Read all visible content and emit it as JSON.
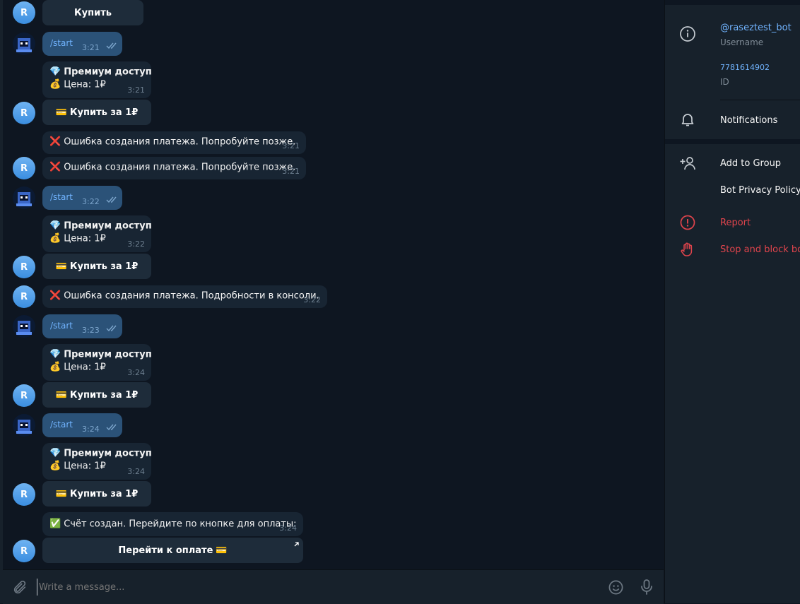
{
  "chat": {
    "top_button": "Купить",
    "outgoing": [
      {
        "text": "/start",
        "time": "3:21"
      },
      {
        "text": "/start",
        "time": "3:22"
      },
      {
        "text": "/start",
        "time": "3:23"
      },
      {
        "text": "/start",
        "time": "3:24"
      }
    ],
    "offers": [
      {
        "title": "Премиум доступ",
        "price": "Цена: 1₽",
        "time": "3:21",
        "button": "Купить за 1₽"
      },
      {
        "title": "Премиум доступ",
        "price": "Цена: 1₽",
        "time": "3:22",
        "button": "Купить за 1₽"
      },
      {
        "title": "Премиум доступ",
        "price": "Цена: 1₽",
        "time": "3:24",
        "button": "Купить за 1₽"
      },
      {
        "title": "Премиум доступ",
        "price": "Цена: 1₽",
        "time": "3:24",
        "button": "Купить за 1₽"
      }
    ],
    "errors": [
      {
        "text": "Ошибка создания платежа. Попробуйте позже.",
        "time": "3:21"
      },
      {
        "text": "Ошибка создания платежа. Попробуйте позже.",
        "time": "3:21"
      },
      {
        "text": "Ошибка создания платежа. Подробности в консоли.",
        "time": "3:22"
      }
    ],
    "invoice": {
      "text": "Счёт создан. Перейдите по кнопке для оплаты:",
      "time": "3:24",
      "button": "Перейти к оплате"
    },
    "bot_avatar_letter": "R"
  },
  "composer": {
    "placeholder": "Write a message..."
  },
  "sidebar": {
    "username": "@raseztest_bot",
    "username_label": "Username",
    "id_value": "7781614902",
    "id_label": "ID",
    "notifications": "Notifications",
    "add_to_group": "Add to Group",
    "privacy_policy": "Bot Privacy Policy",
    "report": "Report",
    "stop_block": "Stop and block bot"
  },
  "colors": {
    "background": "#0e1621",
    "panel": "#17212b",
    "incoming_bubble": "#182533",
    "outgoing_bubble": "#2b5278",
    "link": "#71b4ff",
    "danger": "#e0444c"
  }
}
